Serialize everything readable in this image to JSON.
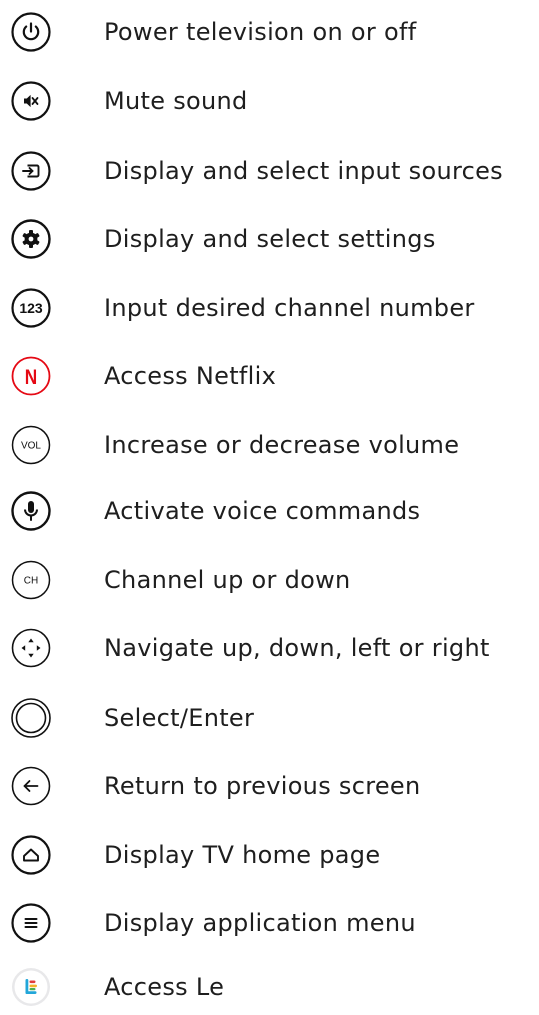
{
  "legend": {
    "items": [
      {
        "icon": "power-icon",
        "label": "Power television on or off"
      },
      {
        "icon": "mute-icon",
        "label": "Mute sound"
      },
      {
        "icon": "input-source-icon",
        "label": "Display and select input sources"
      },
      {
        "icon": "settings-gear-icon",
        "label": "Display and select settings"
      },
      {
        "icon": "number-pad-icon",
        "glyph": "123",
        "label": "Input desired channel number"
      },
      {
        "icon": "netflix-icon",
        "glyph": "N",
        "color": "#e50914",
        "label": "Access Netflix"
      },
      {
        "icon": "volume-icon",
        "glyph": "VOL",
        "label": "Increase or decrease volume"
      },
      {
        "icon": "microphone-icon",
        "label": "Activate voice commands"
      },
      {
        "icon": "channel-icon",
        "glyph": "CH",
        "label": "Channel up or down"
      },
      {
        "icon": "navigation-dpad-icon",
        "label": "Navigate up, down, left or right"
      },
      {
        "icon": "select-enter-icon",
        "label": "Select/Enter"
      },
      {
        "icon": "back-arrow-icon",
        "label": "Return to previous screen"
      },
      {
        "icon": "home-icon",
        "label": "Display TV home page"
      },
      {
        "icon": "menu-icon",
        "label": "Display application menu"
      },
      {
        "icon": "le-app-icon",
        "label": "Access Le"
      }
    ]
  }
}
